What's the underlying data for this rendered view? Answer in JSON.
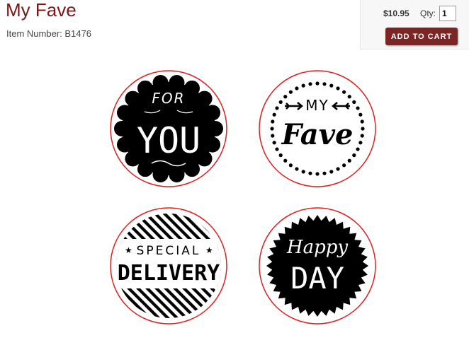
{
  "product": {
    "title": "My Fave",
    "item_number": "Item Number: B1476"
  },
  "purchase": {
    "price": "$10.95",
    "qty_label": "Qty:",
    "qty_value": "1",
    "add_to_cart_label": "ADD TO CART"
  },
  "stickers": [
    {
      "name": "for-you",
      "line1": "FOR",
      "line2": "YOU"
    },
    {
      "name": "my-fave",
      "line1": "MY",
      "line2": "Fave"
    },
    {
      "name": "special-delivery",
      "line1": "SPECIAL",
      "line2": "DELIVERY"
    },
    {
      "name": "happy-day",
      "line1": "Happy",
      "line2": "DAY"
    }
  ],
  "colors": {
    "title": "#7a1717",
    "button": "#7c2525",
    "cut_line": "#e02020"
  }
}
